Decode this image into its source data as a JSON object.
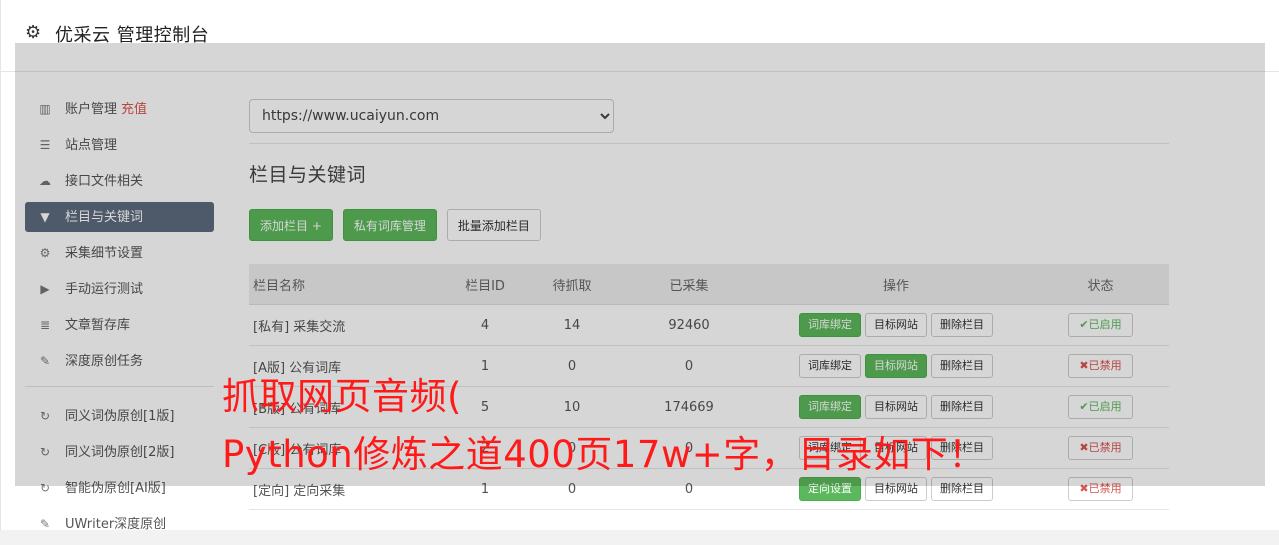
{
  "header": {
    "title": "优采云 管理控制台",
    "icon": "gear-icon"
  },
  "sidebar": {
    "items": [
      {
        "label": "账户管理",
        "extra": "充值",
        "icon": "bar-chart-icon",
        "glyph": "📊"
      },
      {
        "label": "站点管理",
        "icon": "server-icon",
        "glyph": "☰"
      },
      {
        "label": "接口文件相关",
        "icon": "cloud-download-icon",
        "glyph": "☁"
      },
      {
        "label": "栏目与关键词",
        "icon": "filter-icon",
        "glyph": "▼",
        "active": true
      },
      {
        "label": "采集细节设置",
        "icon": "gears-icon",
        "glyph": "⚙"
      },
      {
        "label": "手动运行测试",
        "icon": "play-icon",
        "glyph": "▶"
      },
      {
        "label": "文章暂存库",
        "icon": "database-icon",
        "glyph": "☰"
      },
      {
        "label": "深度原创任务",
        "icon": "edit-icon",
        "glyph": "✎"
      }
    ],
    "items2": [
      {
        "label": "同义词伪原创[1版]",
        "icon": "refresh-icon",
        "glyph": "↻"
      },
      {
        "label": "同义词伪原创[2版]",
        "icon": "refresh-icon",
        "glyph": "↻"
      },
      {
        "label": "智能伪原创[AI版]",
        "icon": "refresh-icon",
        "glyph": "↻"
      },
      {
        "label": "UWriter深度原创",
        "icon": "edit-icon",
        "glyph": "✎"
      }
    ]
  },
  "main": {
    "site_select": "https://www.ucaiyun.com",
    "section_title": "栏目与关键词",
    "buttons": {
      "add_column": "添加栏目 +",
      "private_lib": "私有词库管理",
      "batch_add": "批量添加栏目"
    },
    "table": {
      "headers": [
        "栏目名称",
        "栏目ID",
        "待抓取",
        "已采集",
        "操作",
        "状态"
      ],
      "rows": [
        {
          "name": "[私有] 采集交流",
          "id": "4",
          "pending": "14",
          "collected": "92460",
          "op1": "词库绑定",
          "op2": "目标网站",
          "op3": "删除栏目",
          "status": "✔已启用"
        },
        {
          "name": "[A版] 公有词库",
          "id": "1",
          "pending": "0",
          "collected": "0",
          "op1": "词库绑定",
          "op2": "目标网站",
          "op3": "删除栏目",
          "status": "✖已禁用"
        },
        {
          "name": "[B版] 公有词库",
          "id": "5",
          "pending": "10",
          "collected": "174669",
          "op1": "词库绑定",
          "op2": "目标网站",
          "op3": "删除栏目",
          "status": "✔已启用"
        },
        {
          "name": "[C版] 公有词库",
          "id": "2",
          "pending": "0",
          "collected": "0",
          "op1": "词库绑定",
          "op2": "目标网站",
          "op3": "删除栏目",
          "status": "✖已禁用"
        },
        {
          "name": "[定向] 定向采集",
          "id": "1",
          "pending": "0",
          "collected": "0",
          "op1": "定向设置",
          "op2": "目标网站",
          "op3": "删除栏目",
          "status": "✖已禁用"
        }
      ]
    }
  },
  "caption": {
    "line1": "抓取网页音频(",
    "line2": "Python修炼之道400页17w+字，目录如下！"
  }
}
